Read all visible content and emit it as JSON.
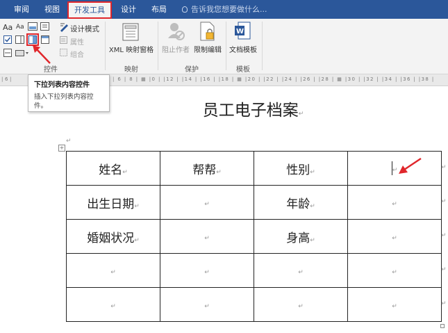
{
  "tabs": [
    {
      "label": "审阅",
      "active": false
    },
    {
      "label": "视图",
      "active": false
    },
    {
      "label": "开发工具",
      "active": true
    },
    {
      "label": "设计",
      "active": false
    },
    {
      "label": "布局",
      "active": false
    }
  ],
  "tell_me": "告诉我您想要做什么...",
  "ribbon": {
    "controls": {
      "label": "控件",
      "design_mode": "设计模式",
      "properties": "属性",
      "group": "组合"
    },
    "mapping": {
      "label": "映射",
      "xml_pane": "XML 映射窗格"
    },
    "protect": {
      "label": "保护",
      "block_authors": "阻止作者",
      "restrict_editing": "限制编辑"
    },
    "templates": {
      "label": "模板",
      "document_template": "文档模板"
    }
  },
  "tooltip": {
    "title": "下拉列表内容控件",
    "description": "插入下拉列表内容控件。"
  },
  "document": {
    "title": "员工电子档案",
    "table": [
      [
        "姓名",
        "帮帮",
        "性别",
        ""
      ],
      [
        "出生日期",
        "",
        "年龄",
        ""
      ],
      [
        "婚姻状况",
        "",
        "身高",
        ""
      ],
      [
        "",
        "",
        "",
        ""
      ],
      [
        "",
        "",
        "",
        ""
      ]
    ]
  },
  "colors": {
    "accent": "#2b579a",
    "highlight": "#e0262b"
  },
  "icons": [
    "lightbulb-icon",
    "text-control-icon",
    "checkbox-control-icon",
    "dropdown-list-control-icon",
    "design-mode-icon",
    "xml-mapping-icon",
    "block-authors-icon",
    "restrict-editing-icon",
    "document-template-icon",
    "table-move-handle-icon"
  ]
}
